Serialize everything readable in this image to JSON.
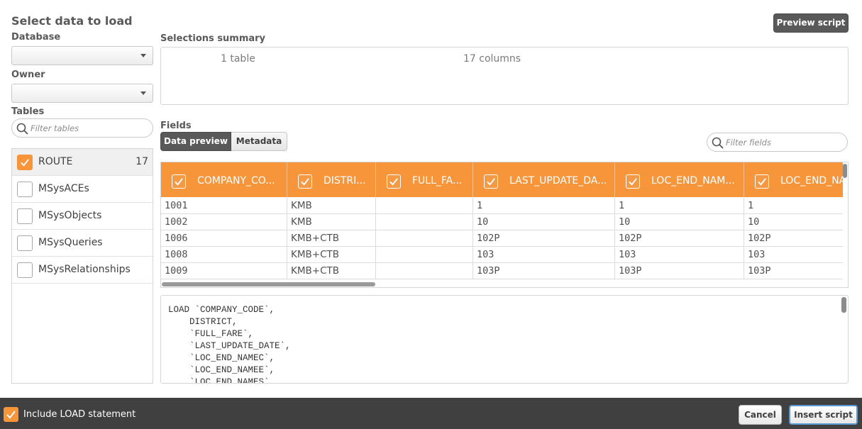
{
  "title": "Select data to load",
  "preview_button": "Preview script",
  "database": {
    "label": "Database",
    "value": ""
  },
  "owner": {
    "label": "Owner",
    "value": ""
  },
  "tables": {
    "label": "Tables",
    "filter_placeholder": "Filter tables",
    "items": [
      {
        "name": "ROUTE",
        "count": "17",
        "checked": true
      },
      {
        "name": "MSysACEs",
        "count": "",
        "checked": false
      },
      {
        "name": "MSysObjects",
        "count": "",
        "checked": false
      },
      {
        "name": "MSysQueries",
        "count": "",
        "checked": false
      },
      {
        "name": "MSysRelationships",
        "count": "",
        "checked": false
      }
    ]
  },
  "summary": {
    "label": "Selections summary",
    "tables": "1 table",
    "columns": "17 columns"
  },
  "fields": {
    "label": "Fields",
    "tab_preview": "Data preview",
    "tab_metadata": "Metadata",
    "filter_placeholder": "Filter fields",
    "columns": [
      "COMPANY_CO...",
      "DISTRI...",
      "FULL_FA...",
      "LAST_UPDATE_DA...",
      "LOC_END_NAM...",
      "LOC_END_NA"
    ],
    "rows": [
      [
        "1001",
        "KMB",
        "",
        "1",
        "1",
        "1"
      ],
      [
        "1002",
        "KMB",
        "",
        "10",
        "10",
        "10"
      ],
      [
        "1006",
        "KMB+CTB",
        "",
        "102P",
        "102P",
        "102P"
      ],
      [
        "1008",
        "KMB+CTB",
        "",
        "103",
        "103",
        "103"
      ],
      [
        "1009",
        "KMB+CTB",
        "",
        "103P",
        "103P",
        "103P"
      ]
    ]
  },
  "script_lines": [
    "LOAD `COMPANY_CODE`,",
    "    DISTRICT,",
    "    `FULL_FARE`,",
    "    `LAST_UPDATE_DATE`,",
    "    `LOC_END_NAMEC`,",
    "    `LOC_END_NAMEE`,",
    "    `LOC_END_NAMES`,"
  ],
  "footer": {
    "include_load_label": "Include LOAD statement",
    "include_load_checked": true,
    "cancel": "Cancel",
    "insert": "Insert script"
  },
  "colors": {
    "accent": "#f7953a",
    "footer_bg": "#404040",
    "dark_button": "#595959"
  },
  "icons": [
    "search-icon",
    "chevron-down-icon",
    "checkmark-icon"
  ]
}
